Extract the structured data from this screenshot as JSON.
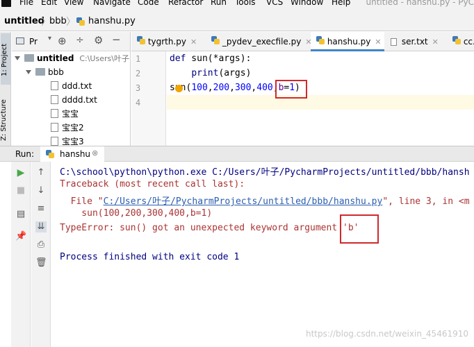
{
  "window_title": "untitled - hanshu.py - PyC",
  "menu": [
    "File",
    "Edit",
    "View",
    "Navigate",
    "Code",
    "Refactor",
    "Run",
    "Tools",
    "VCS",
    "Window",
    "Help"
  ],
  "breadcrumb": {
    "project": "untitled",
    "folder": "bbb",
    "file": "hanshu.py"
  },
  "side_tabs": {
    "project": "1: Project",
    "structure": "Z: Structure"
  },
  "project_panel": {
    "title": "Pr",
    "tree": [
      {
        "label": "untitled",
        "hint": "C:\\Users\\叶子"
      },
      {
        "label": "bbb"
      },
      {
        "label": "ddd.txt"
      },
      {
        "label": "dddd.txt"
      },
      {
        "label": "宝宝"
      },
      {
        "label": "宝宝2"
      },
      {
        "label": "宝宝3"
      }
    ]
  },
  "editor_tabs": [
    "tygrth.py",
    "_pydev_execfile.py",
    "hanshu.py",
    "ser.txt",
    "cc."
  ],
  "line_numbers": [
    "1",
    "2",
    "3",
    "4"
  ],
  "code": {
    "l1_kw": "def",
    "l1_rest": " sun(*args):",
    "l2_fn": "print",
    "l2_rest": "(args)",
    "l3_a": "sun(",
    "l3_n1": "100",
    "l3_n2": "200",
    "l3_n3": "300",
    "l3_n4": "400",
    "l3_param": "b",
    "l3_eq": "=",
    "l3_n5": "1",
    "l3_close": ")"
  },
  "run_panel": {
    "label": "Run:",
    "config": "hanshu"
  },
  "console": {
    "cmd": "C:\\school\\python\\python.exe C:/Users/叶子/PycharmProjects/untitled/bbb/hansh",
    "traceback": "Traceback (most recent call last):",
    "file_prefix": "  File \"",
    "file_link": "C:/Users/叶子/PycharmProjects/untitled/bbb/hanshu.py",
    "file_suffix": "\", line 3, in <m",
    "code_line": "    sun(100,200,300,400,b=1)",
    "error": "TypeError: sun() got an unexpected keyword argument 'b'",
    "exit": "Process finished with exit code 1"
  },
  "watermark": "https://blog.csdn.net/weixin_45461910",
  "colors": {
    "accent": "#4083c9",
    "error": "#d0282e",
    "link": "#2a5db0",
    "run_green": "#4aa84a"
  }
}
